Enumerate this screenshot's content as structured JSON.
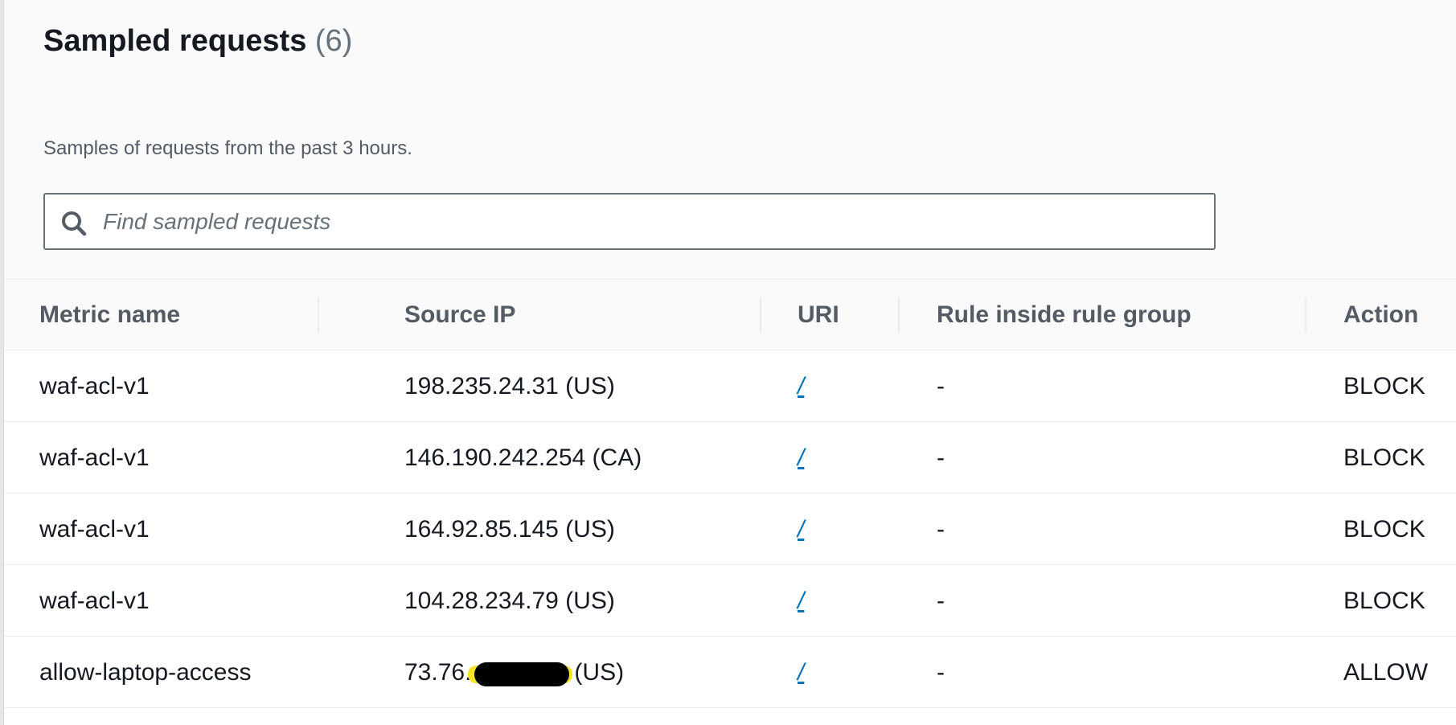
{
  "header": {
    "title": "Sampled requests",
    "count": "(6)",
    "description": "Samples of requests from the past 3 hours."
  },
  "search": {
    "placeholder": "Find sampled requests",
    "icon": "search-icon"
  },
  "table": {
    "columns": [
      "Metric name",
      "Source IP",
      "URI",
      "Rule inside rule group",
      "Action"
    ],
    "rows": [
      {
        "metric": "waf-acl-v1",
        "source_ip": "198.235.24.31 (US)",
        "uri": "/",
        "rule": "-",
        "action": "BLOCK"
      },
      {
        "metric": "waf-acl-v1",
        "source_ip": "146.190.242.254 (CA)",
        "uri": "/",
        "rule": "-",
        "action": "BLOCK"
      },
      {
        "metric": "waf-acl-v1",
        "source_ip": "164.92.85.145 (US)",
        "uri": "/",
        "rule": "-",
        "action": "BLOCK"
      },
      {
        "metric": "waf-acl-v1",
        "source_ip": "104.28.234.79 (US)",
        "uri": "/",
        "rule": "-",
        "action": "BLOCK"
      },
      {
        "metric": "allow-laptop-access",
        "source_ip_prefix": "73.76.",
        "source_ip_suffix": "(US)",
        "uri": "/",
        "rule": "-",
        "action": "ALLOW"
      }
    ]
  }
}
